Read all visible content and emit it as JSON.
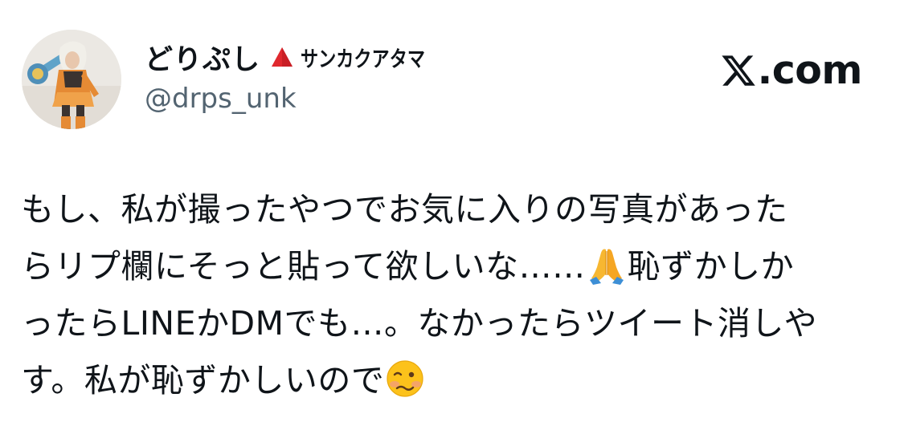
{
  "author": {
    "display_name": "どりぷし",
    "name_icon": "red-triangle-icon",
    "name_suffix": "サンカクアタマ",
    "handle": "@drps_unk",
    "avatar_icon": "profile-avatar"
  },
  "brand": {
    "logo_icon": "x-logo-icon",
    "domain": ".com"
  },
  "tweet": {
    "line1": "もし、私が撮ったやつでお気に入りの写真があった",
    "line2_before": "らリプ欄にそっと貼って欲しいな……",
    "line2_emoji": "folded-hands-icon",
    "line2_after": "恥ずかしか",
    "line3": "ったらLINEかDMでも…。なかったらツイート消しや",
    "line4_before": "す。私が恥ずかしいので",
    "line4_emoji": "woozy-face-icon"
  },
  "colors": {
    "text": "#0f1419",
    "secondary_text": "#536471",
    "triangle": "#e0282e",
    "background": "#ffffff"
  }
}
